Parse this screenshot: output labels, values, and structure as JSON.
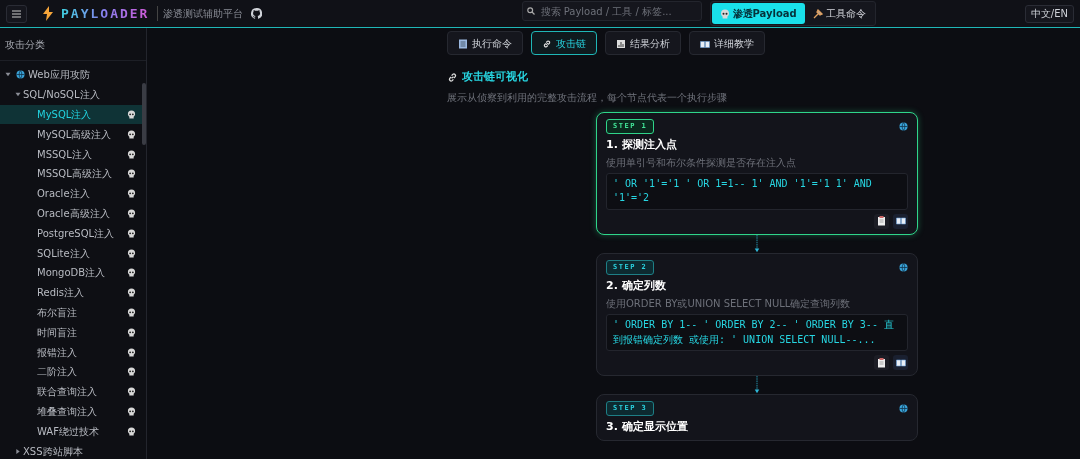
{
  "header": {
    "logo_text": "PAYLOADER",
    "subtitle": "渗透测试辅助平台",
    "search": {
      "placeholder": "搜索 Payload / 工具 / 标签..."
    },
    "modes": [
      {
        "label": "渗透Payload",
        "selected": true
      },
      {
        "label": "工具命令",
        "selected": false
      }
    ],
    "language_button": "中文/EN"
  },
  "sidebar": {
    "title": "攻击分类",
    "tree": [
      {
        "label": "Web应用攻防",
        "expanded": true,
        "children": [
          {
            "label": "SQL/NoSQL注入",
            "expanded": true,
            "children": [
              {
                "label": "MySQL注入",
                "selected": true
              },
              {
                "label": "MySQL高级注入",
                "selected": false
              },
              {
                "label": "MSSQL注入",
                "selected": false
              },
              {
                "label": "MSSQL高级注入",
                "selected": false
              },
              {
                "label": "Oracle注入",
                "selected": false
              },
              {
                "label": "Oracle高级注入",
                "selected": false
              },
              {
                "label": "PostgreSQL注入",
                "selected": false
              },
              {
                "label": "SQLite注入",
                "selected": false
              },
              {
                "label": "MongoDB注入",
                "selected": false
              },
              {
                "label": "Redis注入",
                "selected": false
              },
              {
                "label": "布尔盲注",
                "selected": false
              },
              {
                "label": "时间盲注",
                "selected": false
              },
              {
                "label": "报错注入",
                "selected": false
              },
              {
                "label": "二阶注入",
                "selected": false
              },
              {
                "label": "联合查询注入",
                "selected": false
              },
              {
                "label": "堆叠查询注入",
                "selected": false
              },
              {
                "label": "WAF绕过技术",
                "selected": false
              }
            ]
          },
          {
            "label": "XSS跨站脚本",
            "expanded": false
          }
        ]
      }
    ]
  },
  "tabs": [
    {
      "label": "执行命令",
      "selected": false
    },
    {
      "label": "攻击链",
      "selected": true
    },
    {
      "label": "结果分析",
      "selected": false
    },
    {
      "label": "详细教学",
      "selected": false
    }
  ],
  "section": {
    "title": "攻击链可视化",
    "description": "展示从侦察到利用的完整攻击流程，每个节点代表一个执行步骤"
  },
  "steps": [
    {
      "badge": "STEP 1",
      "title": "1. 探测注入点",
      "description": "使用单引号和布尔条件探测是否存在注入点",
      "code": "' OR '1'='1 ' OR 1=1-- 1' AND '1'='1 1' AND '1'='2",
      "active": true
    },
    {
      "badge": "STEP 2",
      "title": "2. 确定列数",
      "description": "使用ORDER BY或UNION SELECT NULL确定查询列数",
      "code": "' ORDER BY 1-- ' ORDER BY 2-- ' ORDER BY 3-- 直到报错确定列数 或使用: ' UNION SELECT NULL--...",
      "active": false
    },
    {
      "badge": "STEP 3",
      "title": "3. 确定显示位置",
      "active": false
    }
  ]
}
